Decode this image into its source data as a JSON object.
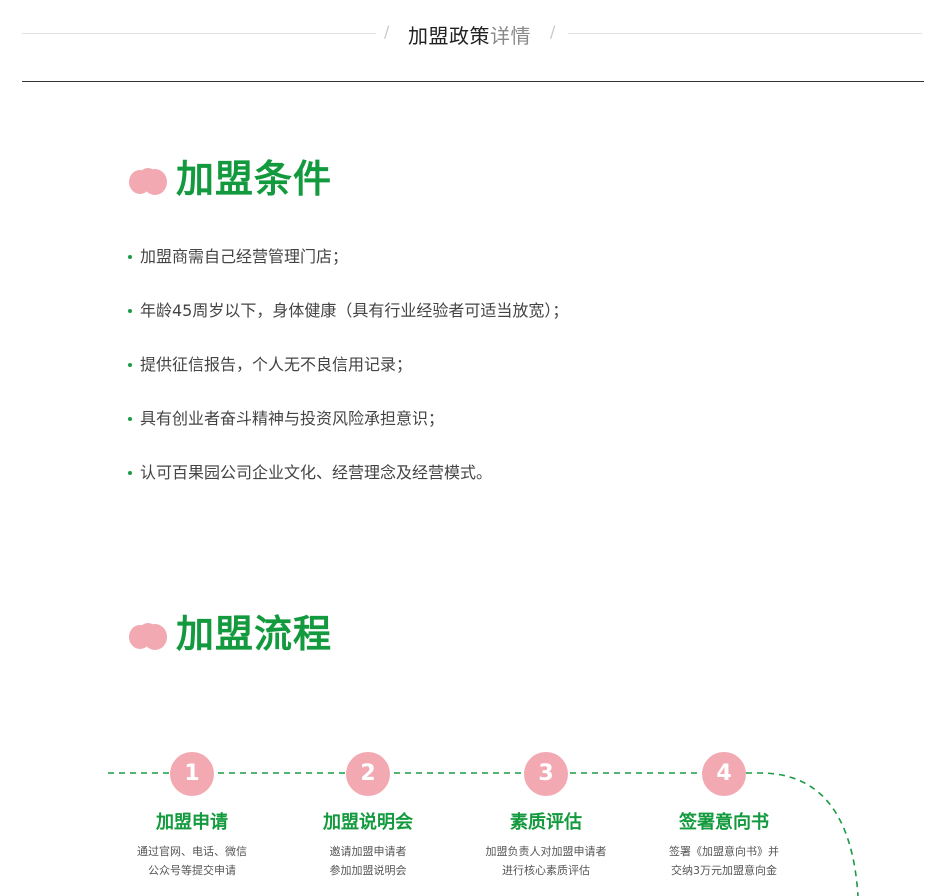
{
  "header": {
    "title_main": "加盟政策",
    "title_tail": "详情",
    "separator": "/"
  },
  "conditions": {
    "title": "加盟条件",
    "items": [
      "加盟商需自己经营管理门店；",
      "年龄45周岁以下，身体健康（具有行业经验者可适当放宽）；",
      "提供征信报告，个人无不良信用记录；",
      "具有创业者奋斗精神与投资风险承担意识；",
      "认可百果园公司企业文化、经营理念及经营模式。"
    ]
  },
  "process": {
    "title": "加盟流程",
    "steps": [
      {
        "num": "1",
        "title": "加盟申请",
        "line1": "通过官网、电话、微信",
        "line2": "公众号等提交申请"
      },
      {
        "num": "2",
        "title": "加盟说明会",
        "line1": "邀请加盟申请者",
        "line2": "参加加盟说明会"
      },
      {
        "num": "3",
        "title": "素质评估",
        "line1": "加盟负责人对加盟申请者",
        "line2": "进行核心素质评估"
      },
      {
        "num": "4",
        "title": "签署意向书",
        "line1": "签署《加盟意向书》并",
        "line2": "交纳3万元加盟意向金"
      }
    ]
  },
  "colors": {
    "brand_green": "#149a3e",
    "accent_pink": "#f3a9b2",
    "text_gray": "#444444"
  },
  "icons": [
    "pink-blob-icon"
  ]
}
